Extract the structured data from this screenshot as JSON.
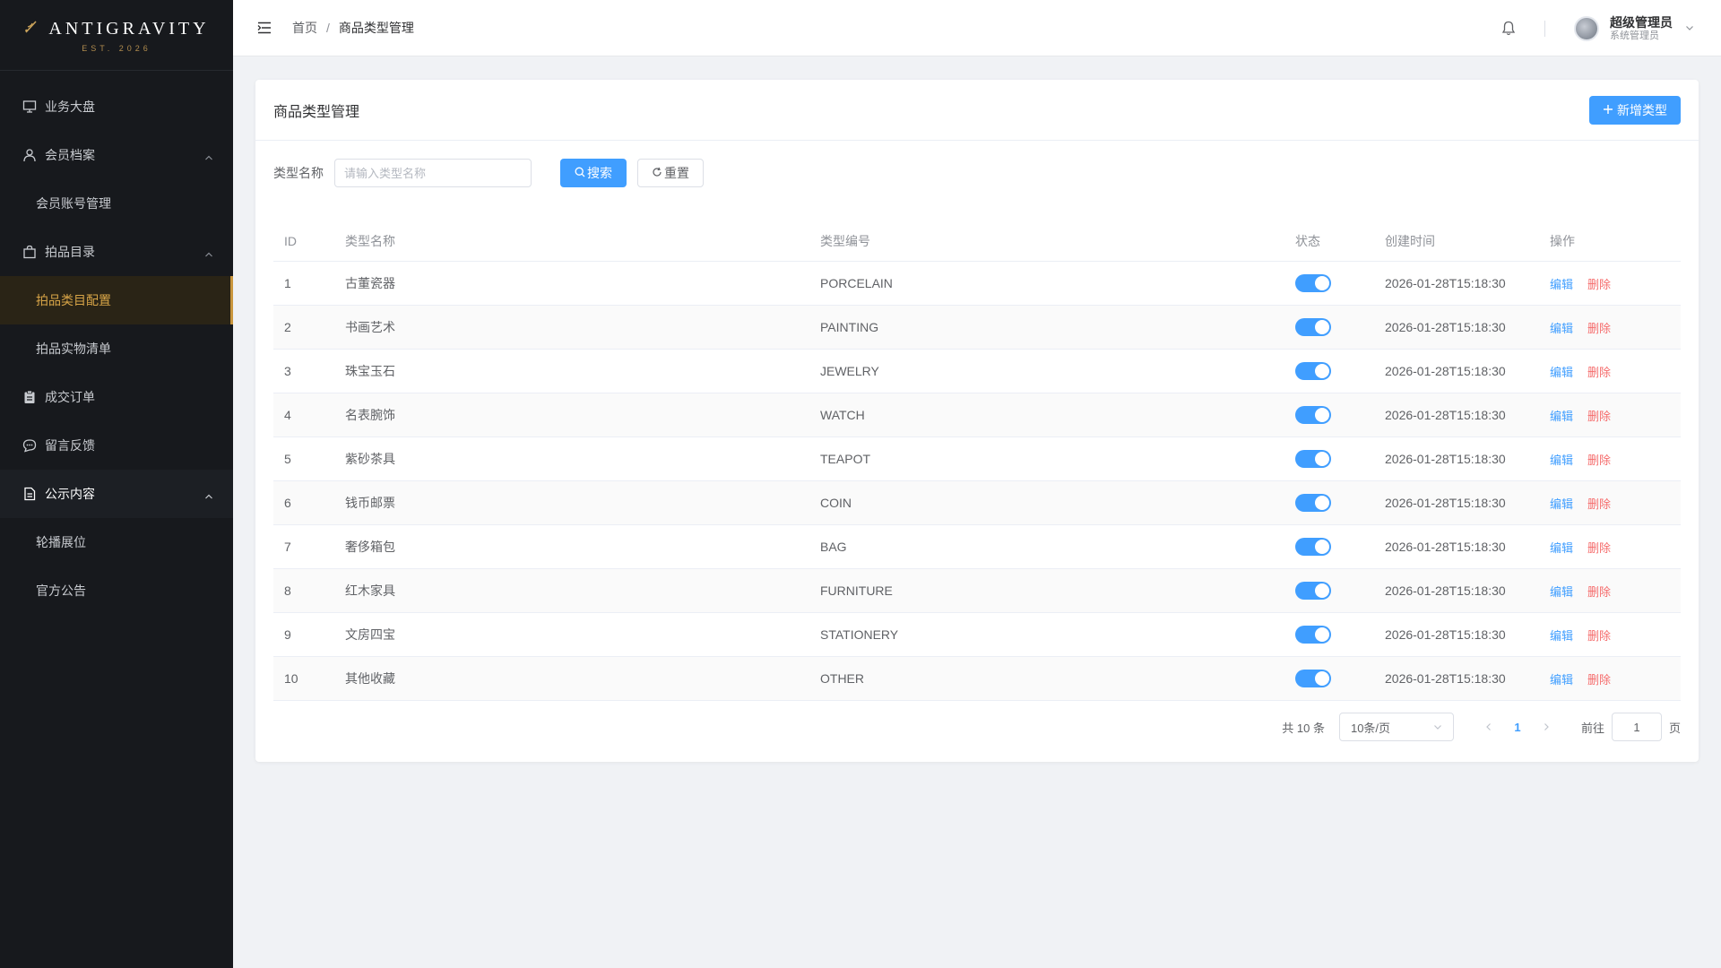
{
  "brand": {
    "name": "ANTIGRAVITY",
    "sub": "EST. 2026"
  },
  "sidebar": {
    "items": [
      {
        "label": "业务大盘",
        "icon": "monitor-icon"
      },
      {
        "label": "会员档案",
        "icon": "user-icon",
        "expanded": true,
        "children": [
          "会员账号管理"
        ]
      },
      {
        "label": "拍品目录",
        "icon": "bag-icon",
        "expanded": true,
        "children": [
          "拍品类目配置",
          "拍品实物清单"
        ]
      },
      {
        "label": "成交订单",
        "icon": "clipboard-icon"
      },
      {
        "label": "留言反馈",
        "icon": "chat-icon"
      },
      {
        "label": "公示内容",
        "icon": "document-icon",
        "expanded": true,
        "children": [
          "轮播展位",
          "官方公告"
        ]
      }
    ],
    "active": "拍品类目配置"
  },
  "header": {
    "breadcrumb": {
      "home": "首页",
      "sep": "/",
      "current": "商品类型管理"
    },
    "user": {
      "name": "超级管理员",
      "role": "系统管理员"
    }
  },
  "card": {
    "title": "商品类型管理",
    "add_label": "新增类型",
    "search": {
      "label": "类型名称",
      "placeholder": "请输入类型名称",
      "search_label": "搜索",
      "reset_label": "重置"
    }
  },
  "table": {
    "columns": {
      "id": "ID",
      "name": "类型名称",
      "code": "类型编号",
      "status": "状态",
      "time": "创建时间",
      "ops": "操作"
    },
    "edit_label": "编辑",
    "delete_label": "删除",
    "rows": [
      {
        "id": "1",
        "name": "古董瓷器",
        "code": "PORCELAIN",
        "enabled": true,
        "time": "2026-01-28T15:18:30"
      },
      {
        "id": "2",
        "name": "书画艺术",
        "code": "PAINTING",
        "enabled": true,
        "time": "2026-01-28T15:18:30"
      },
      {
        "id": "3",
        "name": "珠宝玉石",
        "code": "JEWELRY",
        "enabled": true,
        "time": "2026-01-28T15:18:30"
      },
      {
        "id": "4",
        "name": "名表腕饰",
        "code": "WATCH",
        "enabled": true,
        "time": "2026-01-28T15:18:30"
      },
      {
        "id": "5",
        "name": "紫砂茶具",
        "code": "TEAPOT",
        "enabled": true,
        "time": "2026-01-28T15:18:30"
      },
      {
        "id": "6",
        "name": "钱币邮票",
        "code": "COIN",
        "enabled": true,
        "time": "2026-01-28T15:18:30"
      },
      {
        "id": "7",
        "name": "奢侈箱包",
        "code": "BAG",
        "enabled": true,
        "time": "2026-01-28T15:18:30"
      },
      {
        "id": "8",
        "name": "红木家具",
        "code": "FURNITURE",
        "enabled": true,
        "time": "2026-01-28T15:18:30"
      },
      {
        "id": "9",
        "name": "文房四宝",
        "code": "STATIONERY",
        "enabled": true,
        "time": "2026-01-28T15:18:30"
      },
      {
        "id": "10",
        "name": "其他收藏",
        "code": "OTHER",
        "enabled": true,
        "time": "2026-01-28T15:18:30"
      }
    ]
  },
  "pagination": {
    "total": "共 10 条",
    "page_size": "10条/页",
    "current_page": "1",
    "goto_label": "前往",
    "goto_value": "1",
    "page_suffix": "页"
  },
  "colors": {
    "primary": "#409eff",
    "danger": "#f56c6c",
    "accent": "#c9963d",
    "sidebar_bg": "#17191d"
  }
}
